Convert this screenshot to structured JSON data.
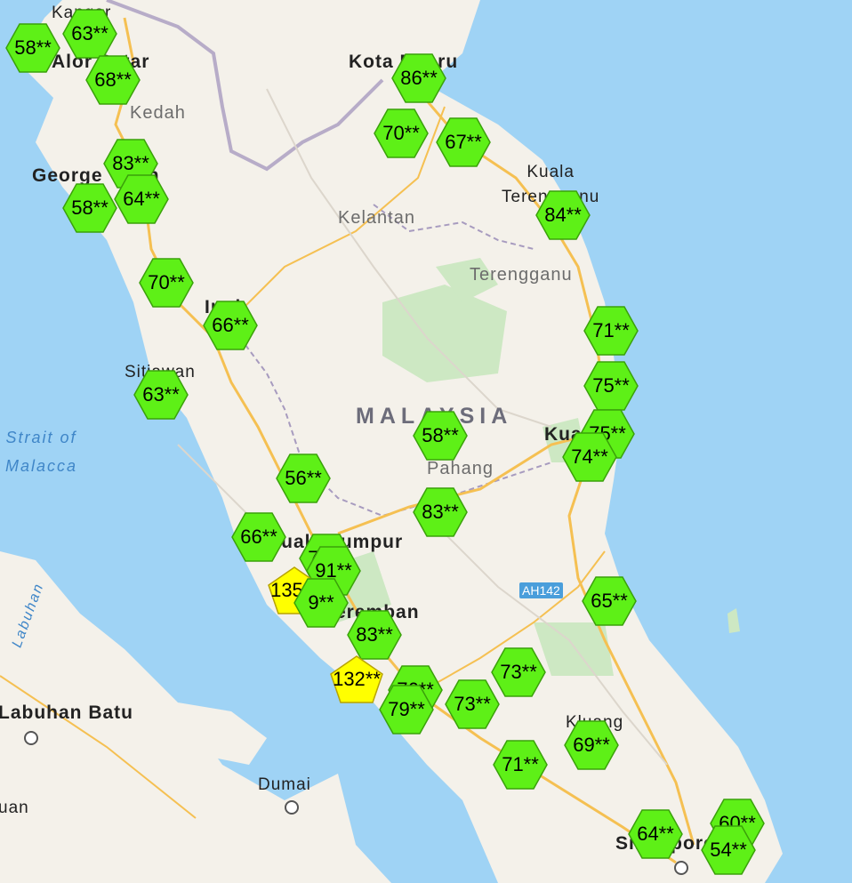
{
  "colors": {
    "sea": "#9fd3f5",
    "land": "#f4f1ea",
    "good": "#5ef017",
    "moderate": "#ffff00",
    "border": "#a79bbf",
    "road": "#f5c052"
  },
  "labels": {
    "kangar": "Kangar",
    "alor_setar": "Alor Setar",
    "kota_bharu": "Kota Bharu",
    "kedah": "Kedah",
    "georgetown": "George Town",
    "kuala_terengganu": "Kuala\nTerengganu",
    "kelantan": "Kelantan",
    "terengganu": "Terengganu",
    "ipoh": "Ipoh",
    "sitiawan": "Sitiawan",
    "strait": "Strait of\nMalacca",
    "malaysia": "MALAYSIA",
    "kuantan": "Kuantan",
    "pahang": "Pahang",
    "kuala_lumpur": "Kuala Lumpur",
    "seremban": "Seremban",
    "ah142": "AH142",
    "labuhan_batu": "Labuhan Batu",
    "dumai": "Dumai",
    "kluang": "Kluang",
    "singapore": "Singapore",
    "labuhan": "Labuhan",
    "uan": "uan"
  },
  "markers": [
    {
      "v": "63**",
      "c": "good"
    },
    {
      "v": "58**",
      "c": "good"
    },
    {
      "v": "68**",
      "c": "good"
    },
    {
      "v": "86**",
      "c": "good"
    },
    {
      "v": "70**",
      "c": "good"
    },
    {
      "v": "67**",
      "c": "good"
    },
    {
      "v": "83**",
      "c": "good"
    },
    {
      "v": "58**",
      "c": "good"
    },
    {
      "v": "64**",
      "c": "good"
    },
    {
      "v": "84**",
      "c": "good"
    },
    {
      "v": "70**",
      "c": "good"
    },
    {
      "v": "66**",
      "c": "good"
    },
    {
      "v": "71**",
      "c": "good"
    },
    {
      "v": "63**",
      "c": "good"
    },
    {
      "v": "75**",
      "c": "good"
    },
    {
      "v": "58**",
      "c": "good"
    },
    {
      "v": "75**",
      "c": "good"
    },
    {
      "v": "74**",
      "c": "good"
    },
    {
      "v": "56**",
      "c": "good"
    },
    {
      "v": "83**",
      "c": "good"
    },
    {
      "v": "66**",
      "c": "good"
    },
    {
      "v": "71**",
      "c": "good"
    },
    {
      "v": "91**",
      "c": "good"
    },
    {
      "v": "135**",
      "c": "moderate"
    },
    {
      "v": "65**",
      "c": "good"
    },
    {
      "v": "9**",
      "c": "good"
    },
    {
      "v": "83**",
      "c": "good"
    },
    {
      "v": "73**",
      "c": "good"
    },
    {
      "v": "132**",
      "c": "moderate"
    },
    {
      "v": "76**",
      "c": "good"
    },
    {
      "v": "79**",
      "c": "good"
    },
    {
      "v": "73**",
      "c": "good"
    },
    {
      "v": "71**",
      "c": "good"
    },
    {
      "v": "69**",
      "c": "good"
    },
    {
      "v": "64**",
      "c": "good"
    },
    {
      "v": "60**",
      "c": "good"
    },
    {
      "v": "54**",
      "c": "good"
    }
  ]
}
